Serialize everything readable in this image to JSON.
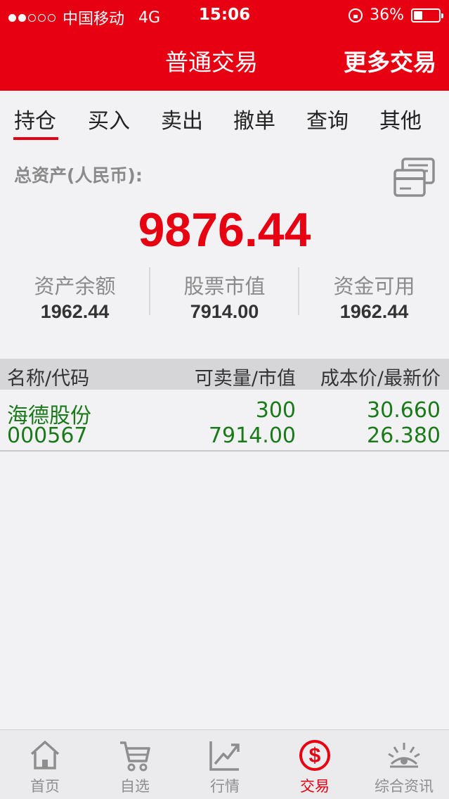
{
  "status": {
    "carrier": "中国移动",
    "network": "4G",
    "time": "15:06",
    "battery": "36%",
    "battery_level": 0.36
  },
  "nav": {
    "title": "普通交易",
    "more": "更多交易"
  },
  "tabs": [
    {
      "label": "持仓"
    },
    {
      "label": "买入"
    },
    {
      "label": "卖出"
    },
    {
      "label": "撤单"
    },
    {
      "label": "查询"
    },
    {
      "label": "其他"
    }
  ],
  "summary": {
    "total_label": "总资产(人民币):",
    "total_value": "9876.44",
    "stats": [
      {
        "label": "资产余额",
        "value": "1962.44"
      },
      {
        "label": "股票市值",
        "value": "7914.00"
      },
      {
        "label": "资金可用",
        "value": "1962.44"
      }
    ]
  },
  "table": {
    "headers": [
      "名称/代码",
      "可卖量/市值",
      "成本价/最新价"
    ],
    "rows": [
      {
        "name": "海德股份",
        "code": "000567",
        "sellable": "300",
        "market_value": "7914.00",
        "cost_price": "30.660",
        "latest_price": "26.380"
      }
    ]
  },
  "tabbar": [
    {
      "label": "首页",
      "icon": "home-icon"
    },
    {
      "label": "自选",
      "icon": "cart-icon"
    },
    {
      "label": "行情",
      "icon": "trend-icon"
    },
    {
      "label": "交易",
      "icon": "dollar-icon"
    },
    {
      "label": "综合资讯",
      "icon": "eye-icon"
    }
  ],
  "colors": {
    "brand_red": "#e60012",
    "gain_green": "#1a7a1a",
    "muted_gray": "#8e8e8e"
  }
}
